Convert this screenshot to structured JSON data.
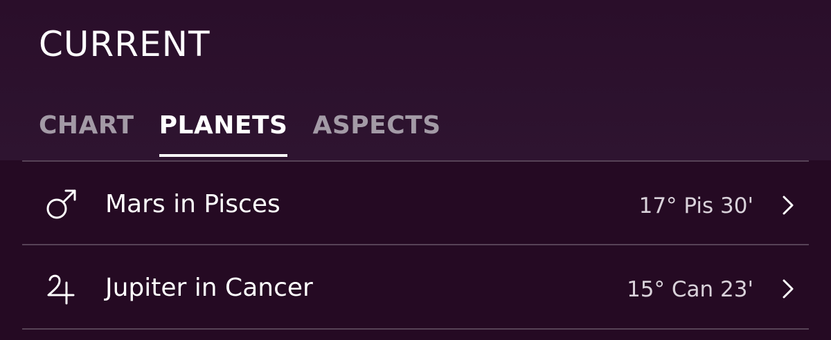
{
  "header": {
    "title": "CURRENT"
  },
  "tabs": [
    {
      "label": "CHART",
      "active": false
    },
    {
      "label": "PLANETS",
      "active": true
    },
    {
      "label": "ASPECTS",
      "active": false
    }
  ],
  "planets": [
    {
      "name": "Mars in Pisces",
      "position": "17° Pis 30'",
      "icon": "mars-icon"
    },
    {
      "name": "Jupiter in Cancer",
      "position": "15° Can 23'",
      "icon": "jupiter-icon"
    }
  ],
  "colors": {
    "background": "#250a23",
    "header_background": "#2c1230",
    "active_tab": "#ffffff",
    "inactive_tab": "#a39aa6",
    "divider": "#574357"
  }
}
